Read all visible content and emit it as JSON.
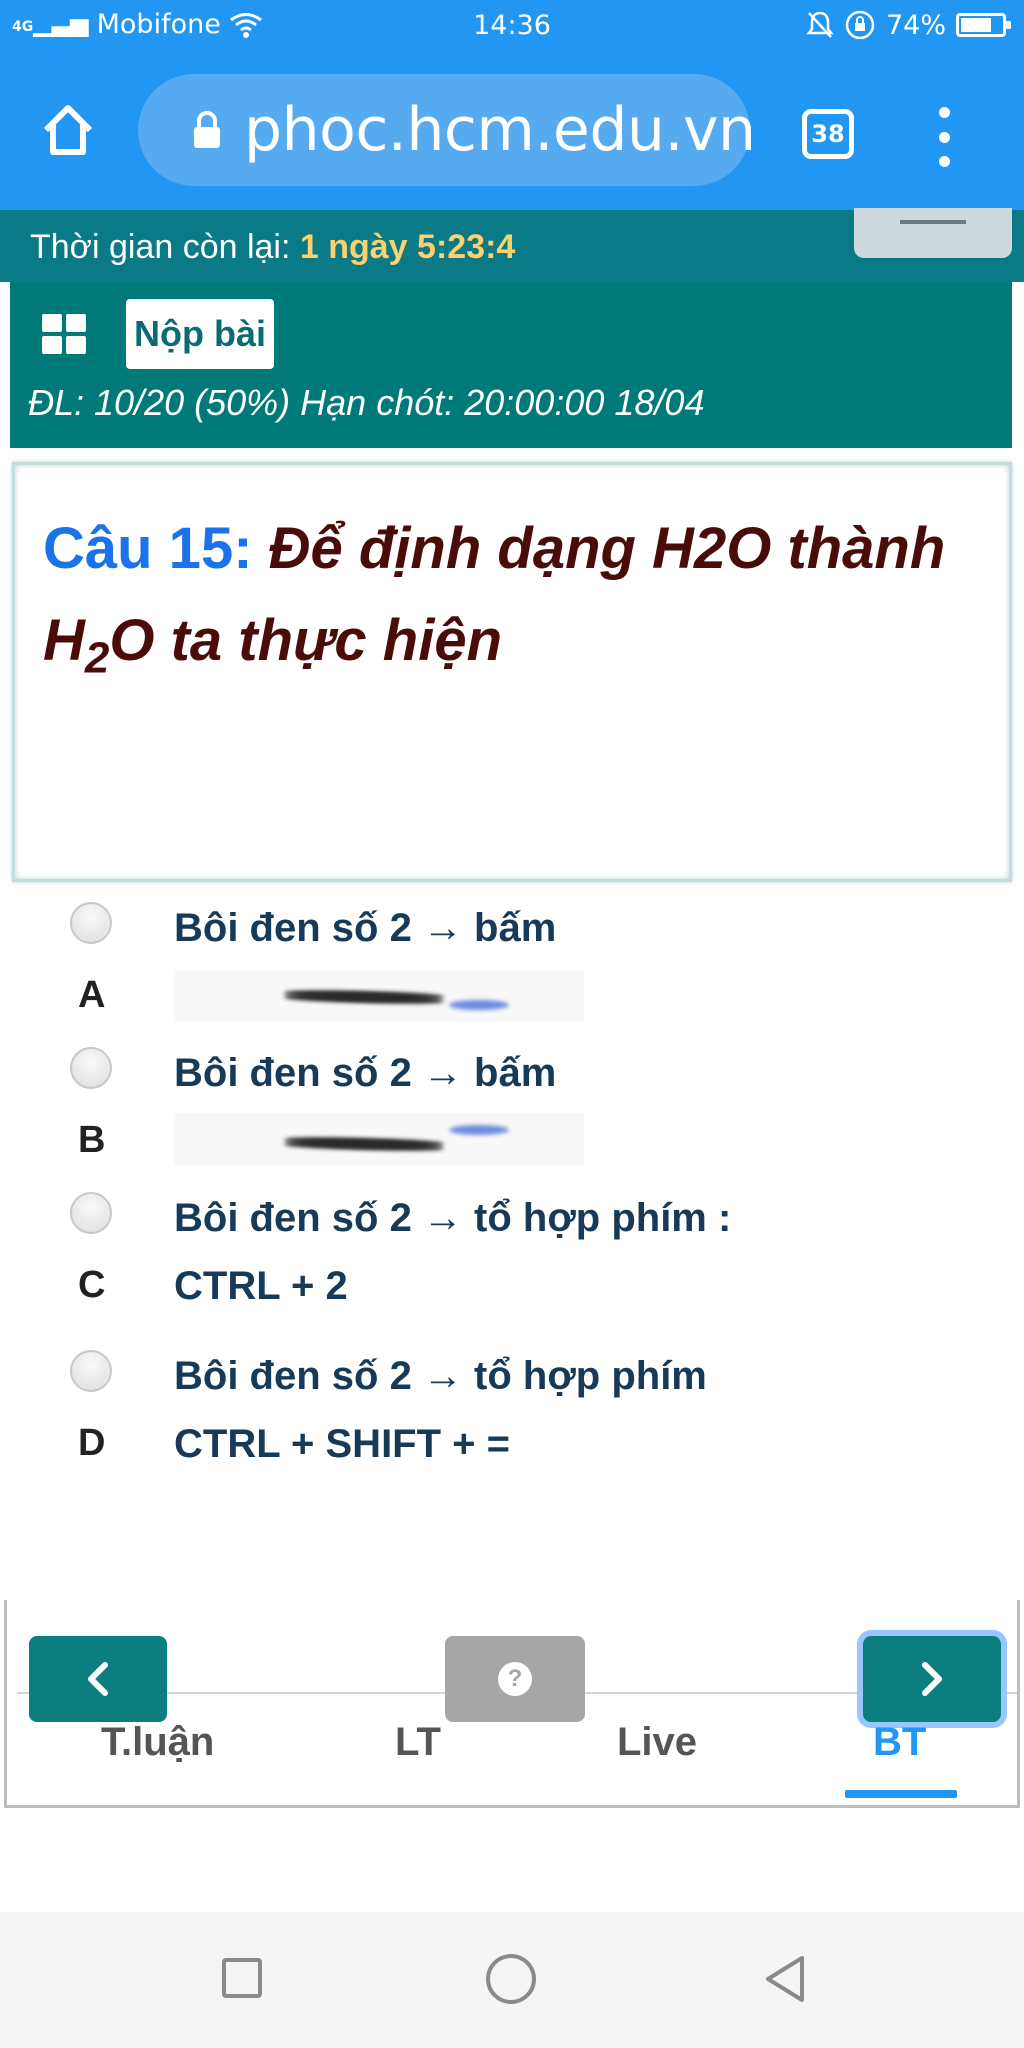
{
  "status_bar": {
    "network": "4G",
    "carrier": "Mobifone",
    "time": "14:36",
    "battery_percent": "74%",
    "battery_level": 0.74
  },
  "browser": {
    "url": "phoc.hcm.edu.vn",
    "tab_count": "38"
  },
  "timer": {
    "label": "Thời gian còn lại: ",
    "value": "1 ngày 5:23:4"
  },
  "submit": {
    "button_label": "Nộp bài",
    "score_deadline": "ĐL: 10/20 (50%)   Hạn chót: 20:00:00 18/04"
  },
  "question": {
    "number": "Câu 15:",
    "text_part1": " Để định dạng H2O thành ",
    "text_part2_h": "H",
    "text_part2_sub": "2",
    "text_part2_rest": "O ta thực hiện"
  },
  "answers": [
    {
      "letter": "A",
      "text": "Bôi đen số 2 → bấm"
    },
    {
      "letter": "B",
      "text": "Bôi đen số 2 → bấm"
    },
    {
      "letter": "C",
      "text": "Bôi đen số 2 → tổ hợp phím :",
      "text2": "CTRL + 2"
    },
    {
      "letter": "D",
      "text": "Bôi đen số 2 → tổ hợp phím",
      "text2": "CTRL + SHIFT + ="
    }
  ],
  "nav": {
    "help_symbol": "?",
    "tabs": [
      "T.luận",
      "LT",
      "Live",
      "BT"
    ],
    "active_tab": "BT"
  },
  "colors": {
    "browser_blue": "#2196f3",
    "teal": "#007a78",
    "timer_value": "#ffd06b",
    "question_number": "#1a73e8",
    "question_text": "#4a0c08",
    "answer_text": "#163a58"
  }
}
